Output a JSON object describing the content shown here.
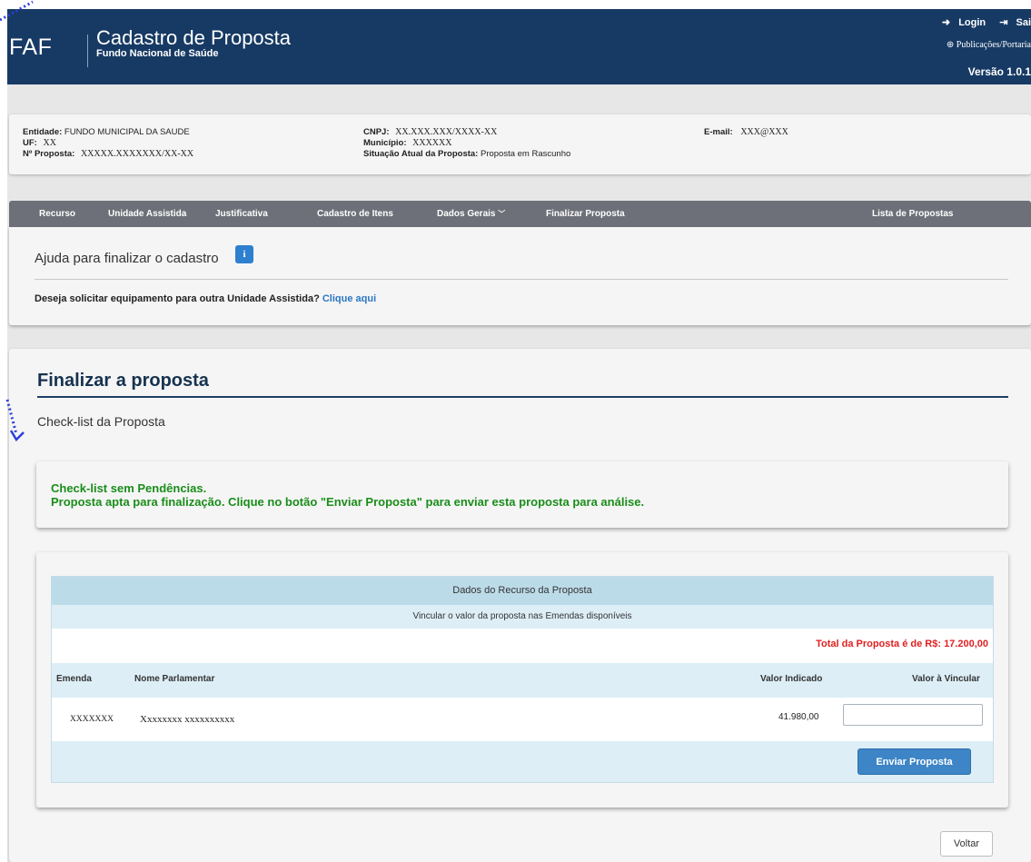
{
  "header": {
    "logo": "FAF",
    "title": "Cadastro de Proposta",
    "subtitle": "Fundo Nacional de Saúde",
    "login": "Login",
    "logout": "Sai",
    "publications": "Publicações/Portaria",
    "version": "Versão 1.0.1"
  },
  "info": {
    "entidade_label": "Entidade:",
    "entidade_value": "FUNDO MUNICIPAL DA SAUDE",
    "uf_label": "UF:",
    "uf_value": "XX",
    "proposta_label": "Nº Proposta:",
    "proposta_value": "XXXXX.XXXXXXX/XX-XX",
    "cnpj_label": "CNPJ:",
    "cnpj_value": "XX.XXX.XXX/XXXX-XX",
    "municipio_label": "Município:",
    "municipio_value": "XXXXXX",
    "situacao_label": "Situação Atual da Proposta:",
    "situacao_value": "Proposta em Rascunho",
    "email_label": "E-mail:",
    "email_value": "XXX@XXX"
  },
  "nav": {
    "items": [
      "Recurso",
      "Unidade Assistida",
      "Justificativa",
      "Cadastro de Itens",
      "Dados Gerais",
      "Finalizar Proposta"
    ],
    "right": "Lista de Propostas"
  },
  "help": {
    "title": "Ajuda para finalizar o cadastro",
    "info_glyph": "i",
    "question": "Deseja solicitar equipamento para outra Unidade Assistida?",
    "link": "Clique aqui"
  },
  "main": {
    "title": "Finalizar a proposta",
    "subtitle": "Check-list da Proposta",
    "ok_line1": "Check-list sem Pendências.",
    "ok_line2": "Proposta apta para finalização. Clique no botão \"Enviar Proposta\" para enviar esta proposta para análise."
  },
  "resource": {
    "title": "Dados do Recurso da Proposta",
    "subtitle": "Vincular o valor da proposta nas Emendas disponíveis",
    "total": "Total da Proposta é de R$: 17.200,00",
    "columns": [
      "Emenda",
      "Nome Parlamentar",
      "Valor Indicado",
      "Valor à Vincular"
    ],
    "rows": [
      {
        "emenda": "XXXXXXX",
        "nome": "Xxxxxxxx xxxxxxxxxx",
        "valor": "41.980,00",
        "vincular": ""
      }
    ],
    "send_label": "Enviar Proposta"
  },
  "back_label": "Voltar"
}
